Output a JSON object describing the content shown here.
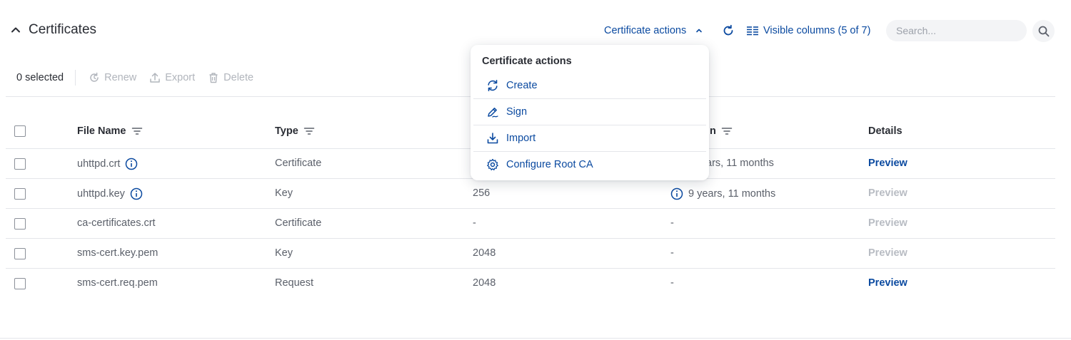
{
  "header": {
    "title": "Certificates",
    "cert_actions_label": "Certificate actions",
    "visible_columns_label": "Visible columns (5 of 7)",
    "search_placeholder": "Search..."
  },
  "toolbar": {
    "selected": "0 selected",
    "renew": "Renew",
    "export": "Export",
    "delete": "Delete"
  },
  "table": {
    "headers": [
      "File Name",
      "Type",
      "in",
      "Details"
    ],
    "rows": [
      {
        "file": "uhttpd.crt",
        "type": "Certificate",
        "size": "",
        "expires": "ars, 11 months",
        "preview": "Preview",
        "preview_enabled": true
      },
      {
        "file": "uhttpd.key",
        "type": "Key",
        "size": "256",
        "expires": "9 years, 11 months",
        "preview": "Preview",
        "preview_enabled": false
      },
      {
        "file": "ca-certificates.crt",
        "type": "Certificate",
        "size": "-",
        "expires": "-",
        "preview": "Preview",
        "preview_enabled": false
      },
      {
        "file": "sms-cert.key.pem",
        "type": "Key",
        "size": "2048",
        "expires": "-",
        "preview": "Preview",
        "preview_enabled": false
      },
      {
        "file": "sms-cert.req.pem",
        "type": "Request",
        "size": "2048",
        "expires": "-",
        "preview": "Preview",
        "preview_enabled": true
      }
    ]
  },
  "dropdown": {
    "title": "Certificate actions",
    "items": [
      {
        "label": "Create",
        "icon": "refresh-cycle-icon"
      },
      {
        "label": "Sign",
        "icon": "pen-icon"
      },
      {
        "label": "Import",
        "icon": "download-icon"
      },
      {
        "label": "Configure Root CA",
        "icon": "gear-icon"
      }
    ]
  },
  "colors": {
    "accent": "#0b4aa0",
    "disabled": "#b8bcc3",
    "text": "#2a2d34",
    "muted": "#5b606a"
  }
}
